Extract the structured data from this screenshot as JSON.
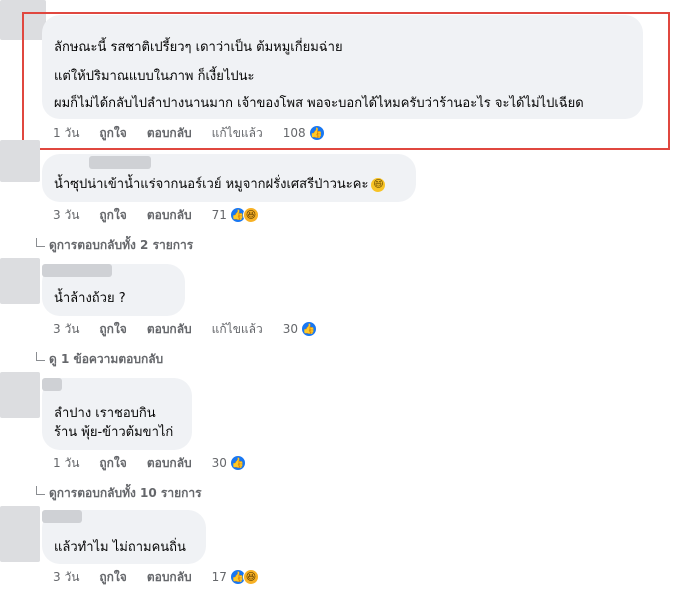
{
  "comments": [
    {
      "lines": [
        "ลักษณะนี้ รสชาติเปรี้ยวๆ เดาว่าเป็น ต้มหมูเกี่ยมฉ่าย",
        "แต่ให้ปริมาณแบบในภาพ ก็เงี้ยไปนะ",
        "ผมก็ไม่ได้กลับไปลำปางนานมาก เจ้าของโพส พอจะบอกได้ไหมครับว่าร้านอะไร จะได้ไม่ไปเฉียด"
      ],
      "time": "1 วัน",
      "like_label": "ถูกใจ",
      "reply_label": "ตอบกลับ",
      "edited_label": "แก้ไขแล้ว",
      "reaction_count": "108",
      "reactions": [
        "like-icon"
      ]
    },
    {
      "lines": [
        "น้ำซุปน่าเข้าน้ำแร่จากนอร์เวย์ หมูจากฝรั่งเศสรีป่าวนะคะ"
      ],
      "trailing_emoji": "😄",
      "time": "3 วัน",
      "like_label": "ถูกใจ",
      "reply_label": "ตอบกลับ",
      "reaction_count": "71",
      "reactions": [
        "like-icon",
        "haha-icon"
      ],
      "replies_label": "ดูการตอบกลับทั้ง 2 รายการ"
    },
    {
      "lines": [
        "น้ำล้างถ้วย ?"
      ],
      "time": "3 วัน",
      "like_label": "ถูกใจ",
      "reply_label": "ตอบกลับ",
      "edited_label": "แก้ไขแล้ว",
      "reaction_count": "30",
      "reactions": [
        "like-icon"
      ],
      "replies_label": "ดู 1 ข้อความตอบกลับ"
    },
    {
      "lines": [
        "ลำปาง เราชอบกิน",
        "ร้าน พุ้ย-ข้าวต้มขาไก่"
      ],
      "time": "1 วัน",
      "like_label": "ถูกใจ",
      "reply_label": "ตอบกลับ",
      "reaction_count": "30",
      "reactions": [
        "like-icon"
      ],
      "replies_label": "ดูการตอบกลับทั้ง 10 รายการ"
    },
    {
      "lines": [
        "แล้วทำไม ไม่ถามคนถิ่น"
      ],
      "time": "3 วัน",
      "like_label": "ถูกใจ",
      "reply_label": "ตอบกลับ",
      "reaction_count": "17",
      "reactions": [
        "like-icon",
        "haha-icon"
      ]
    }
  ],
  "colors": {
    "bubble": "#f0f2f5",
    "meta_text": "#65676b",
    "like_blue": "#1877f2",
    "highlight_red": "#e0473f"
  }
}
